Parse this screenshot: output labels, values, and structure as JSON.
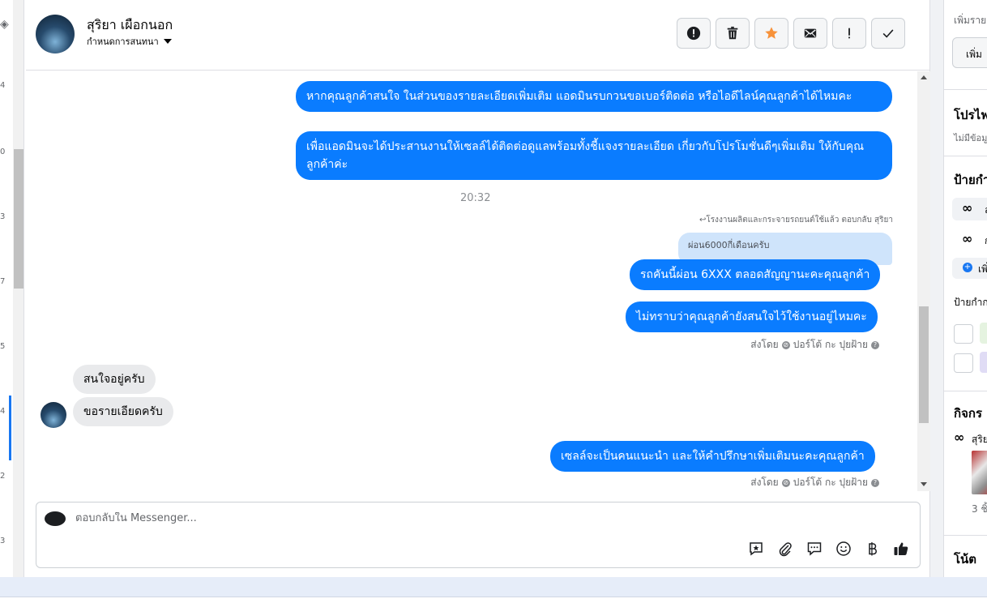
{
  "left_rail": {
    "numbers": [
      "4",
      "0",
      "3",
      "7",
      "5",
      "4",
      "2",
      "3"
    ]
  },
  "header": {
    "contact_name": "สุริยา เผือกนอก",
    "sub_label": "กำหนดการสนทนา",
    "buttons": [
      {
        "name": "spam-button",
        "icon": "alert-circle-icon"
      },
      {
        "name": "delete-button",
        "icon": "trash-icon"
      },
      {
        "name": "star-button",
        "icon": "star-icon",
        "color": "#f7923a"
      },
      {
        "name": "mark-unread-button",
        "icon": "envelope-icon"
      },
      {
        "name": "follow-up-button",
        "icon": "exclamation-icon"
      },
      {
        "name": "done-button",
        "icon": "check-icon"
      }
    ]
  },
  "messages": {
    "out_1": "หากคุณลูกค้าสนใจ ในส่วนของรายละเอียดเพิ่มเติม แอดมินรบกวนขอเบอร์ติดต่อ หรือไอดีไลน์คุณลูกค้าได้ไหมคะ",
    "out_2": "เพื่อแอดมินจะได้ประสานงานให้เซลล์ได้ติดต่อดูแลพร้อมทั้งชี้แจงรายละเอียด เกี่ยวกับโปรโมชั่นดีๆเพิ่มเติม ให้กับคุณลูกค้าค่ะ",
    "time": "20:32",
    "reply_note": "↩โรงงานผลิตและกระจายรถยนต์ใช้แล้ว ตอบกลับ สุริยา",
    "quoted": "ผ่อน6000กี่เดือนครับ",
    "out_3": "รถคันนี้ผ่อน 6XXX ตลอดสัญญานะคะคุณลูกค้า",
    "out_4": "ไม่ทราบว่าคุณลูกค้ายังสนใจไว้ใช้งานอยู่ไหมคะ",
    "sent_by_1": "ส่งโดย",
    "sent_by_1_name": "ปอร์โต้ กะ ปุยฝ้าย",
    "in_1": "สนใจอยู่ครับ",
    "in_2": "ขอรายเอียดครับ",
    "out_5": "เซลล์จะเป็นคนแนะนำ และให้คำปรึกษาเพิ่มเติมนะคะคุณลูกค้า",
    "sent_by_2": "ส่งโดย",
    "sent_by_2_name": "ปอร์โต้ กะ ปุยฝ้าย"
  },
  "composer": {
    "placeholder": "ตอบกลับใน Messenger...",
    "tools": [
      "saved-reply-icon",
      "attach-icon",
      "chat-bubble-icon",
      "emoji-icon",
      "baht-icon",
      "thumbs-up-icon"
    ]
  },
  "right_panel": {
    "top_label": "เพิ่มราย",
    "top_button": "เพิ่ม",
    "profile_title": "โปรไฟ",
    "profile_sub": "ไม่มีข้อมู",
    "labels_title": "ป้ายกำ",
    "label_1": "ล",
    "label_2": "ก",
    "add_label": "เพิ่",
    "labels_sub": "ป้ายกำก",
    "activity_title": "กิจกร",
    "activity_item": "สุริย",
    "activity_count": "3 ชิ้",
    "notes_title": "โน้ต"
  }
}
